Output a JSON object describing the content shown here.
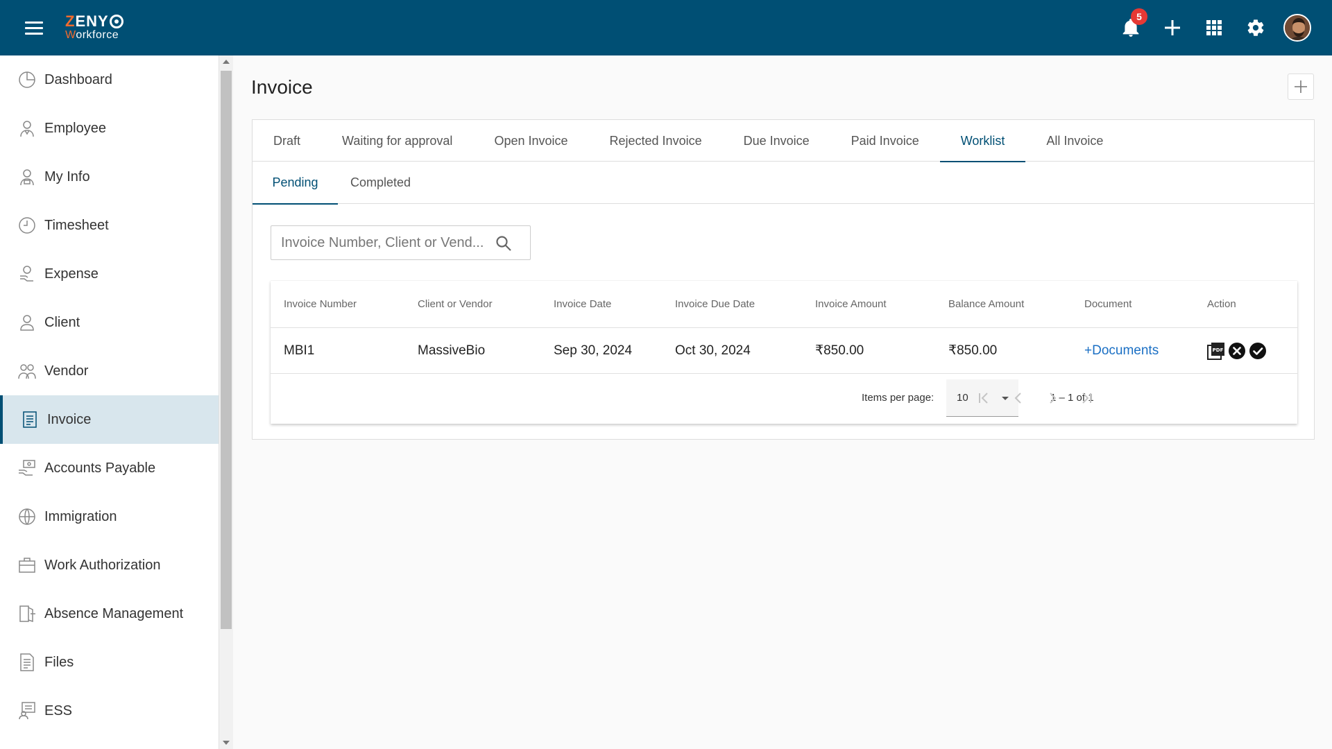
{
  "app": {
    "logo_top": "ZENY",
    "logo_bottom_prefix": "W",
    "logo_bottom_rest": "orkforce"
  },
  "topbar": {
    "notification_count": "5",
    "icons": [
      "bell-icon",
      "plus-icon",
      "apps-grid-icon",
      "gear-icon",
      "avatar"
    ]
  },
  "sidebar": {
    "items": [
      {
        "label": "Dashboard",
        "icon": "dashboard-icon"
      },
      {
        "label": "Employee",
        "icon": "employee-icon"
      },
      {
        "label": "My Info",
        "icon": "my-info-icon"
      },
      {
        "label": "Timesheet",
        "icon": "clock-icon"
      },
      {
        "label": "Expense",
        "icon": "expense-icon"
      },
      {
        "label": "Client",
        "icon": "client-icon"
      },
      {
        "label": "Vendor",
        "icon": "vendor-icon"
      },
      {
        "label": "Invoice",
        "icon": "invoice-icon",
        "active": true
      },
      {
        "label": "Accounts Payable",
        "icon": "accounts-payable-icon"
      },
      {
        "label": "Immigration",
        "icon": "globe-icon"
      },
      {
        "label": "Work Authorization",
        "icon": "briefcase-icon"
      },
      {
        "label": "Absence Management",
        "icon": "door-icon"
      },
      {
        "label": "Files",
        "icon": "file-icon"
      },
      {
        "label": "ESS",
        "icon": "ess-icon"
      }
    ]
  },
  "page": {
    "title": "Invoice"
  },
  "tabs": [
    "Draft",
    "Waiting for approval",
    "Open Invoice",
    "Rejected Invoice",
    "Due Invoice",
    "Paid Invoice",
    "Worklist",
    "All Invoice"
  ],
  "active_tab": "Worklist",
  "subtabs": [
    "Pending",
    "Completed"
  ],
  "active_subtab": "Pending",
  "search": {
    "placeholder": "Invoice Number, Client or Vend..."
  },
  "table": {
    "headers": [
      "Invoice Number",
      "Client or Vendor",
      "Invoice Date",
      "Invoice Due Date",
      "Invoice Amount",
      "Balance Amount",
      "Document",
      "Action"
    ],
    "rows": [
      {
        "invoice_number": "MBI1",
        "client_or_vendor": "MassiveBio",
        "invoice_date": "Sep 30, 2024",
        "invoice_due_date": "Oct 30, 2024",
        "invoice_amount": "₹850.00",
        "balance_amount": "₹850.00",
        "document": "+Documents"
      }
    ]
  },
  "paginator": {
    "items_per_page_label": "Items per page:",
    "items_per_page": "10",
    "range": "1 – 1 of 1"
  },
  "colors": {
    "topbar": "#004f74",
    "accent": "#004f74",
    "logo_orange": "#f26b2d",
    "badge": "#e53935",
    "link": "#1a6fc4",
    "active_sidebar": "#d8e6ed"
  }
}
